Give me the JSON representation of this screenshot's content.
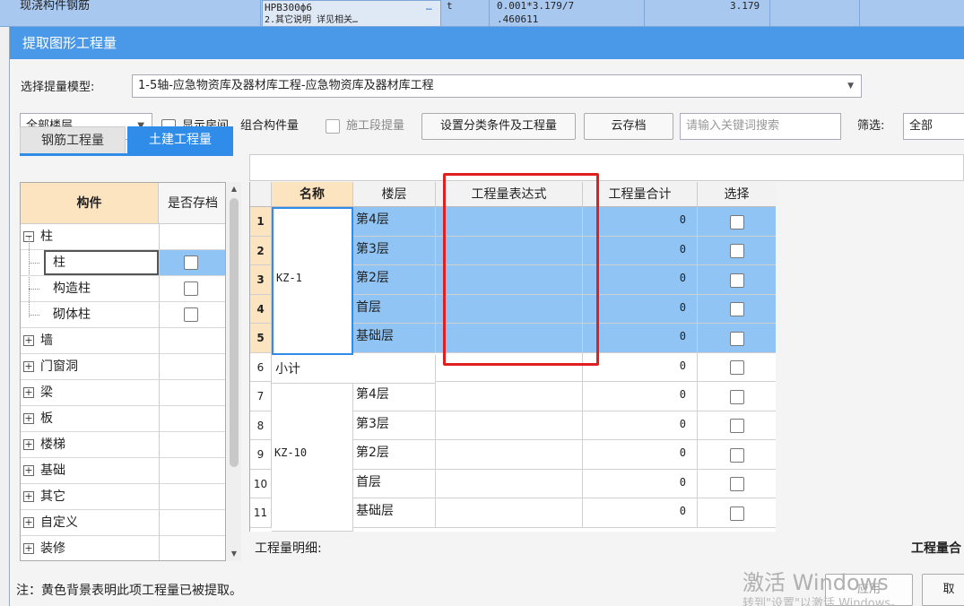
{
  "background_row": {
    "col1": "现浇构件钢筋",
    "col2_line1": "HPB300ф6",
    "col2_line2": "2.其它说明 详见相关…",
    "col2_ellipsis": "…",
    "col3": "t",
    "col4_line1": "0.001*3.179/7",
    "col4_line2": ".460611",
    "col5": "3.179"
  },
  "dialog": {
    "title": "提取图形工程量"
  },
  "model": {
    "label": "选择提量模型:",
    "value": "1-5轴-应急物资库及器材库工程-应急物资库及器材库工程"
  },
  "toolbar": {
    "floor_select": "全部楼层",
    "show_rooms_label": "显示房间、组合构件量",
    "stage_label": "施工段提量",
    "set_btn": "设置分类条件及工程量",
    "cloud_btn": "云存档",
    "search_placeholder": "请输入关键词搜索",
    "filter_label": "筛选:",
    "filter_value": "全部"
  },
  "tabs": [
    {
      "label": "钢筋工程量",
      "active": false
    },
    {
      "label": "土建工程量",
      "active": true
    }
  ],
  "tree": {
    "col_component": "构件",
    "col_saved": "是否存档",
    "items": [
      {
        "label": "柱",
        "expander": "−",
        "level": 0,
        "checkbox": false
      },
      {
        "label": "柱",
        "level": 1,
        "checkbox": true,
        "selected": true
      },
      {
        "label": "构造柱",
        "level": 1,
        "checkbox": true
      },
      {
        "label": "砌体柱",
        "level": 1,
        "checkbox": true
      },
      {
        "label": "墙",
        "expander": "+",
        "level": 0,
        "checkbox": false
      },
      {
        "label": "门窗洞",
        "expander": "+",
        "level": 0,
        "checkbox": false
      },
      {
        "label": "梁",
        "expander": "+",
        "level": 0,
        "checkbox": false
      },
      {
        "label": "板",
        "expander": "+",
        "level": 0,
        "checkbox": false
      },
      {
        "label": "楼梯",
        "expander": "+",
        "level": 0,
        "checkbox": false
      },
      {
        "label": "基础",
        "expander": "+",
        "level": 0,
        "checkbox": false
      },
      {
        "label": "其它",
        "expander": "+",
        "level": 0,
        "checkbox": false
      },
      {
        "label": "自定义",
        "expander": "+",
        "level": 0,
        "checkbox": false
      },
      {
        "label": "装修",
        "expander": "+",
        "level": 0,
        "checkbox": false
      }
    ]
  },
  "grid": {
    "headers": [
      "名称",
      "楼层",
      "工程量表达式",
      "工程量合计",
      "选择"
    ],
    "rows": [
      {
        "n": "1",
        "floor": "第4层",
        "total": "0"
      },
      {
        "n": "2",
        "floor": "第3层",
        "total": "0"
      },
      {
        "n": "3",
        "floor": "第2层",
        "total": "0"
      },
      {
        "n": "4",
        "floor": "首层",
        "total": "0"
      },
      {
        "n": "5",
        "floor": "基础层",
        "total": "0"
      },
      {
        "n": "6",
        "floor": "",
        "total": "0"
      },
      {
        "n": "7",
        "floor": "第4层",
        "total": "0"
      },
      {
        "n": "8",
        "floor": "第3层",
        "total": "0"
      },
      {
        "n": "9",
        "floor": "第2层",
        "total": "0"
      },
      {
        "n": "10",
        "floor": "首层",
        "total": "0"
      },
      {
        "n": "11",
        "floor": "基础层",
        "total": "0"
      }
    ],
    "group1_name": "KZ-1",
    "subtotal_label": "小计",
    "group2_name": "KZ-10"
  },
  "details": {
    "label": "工程量明细:",
    "right_label": "工程量合"
  },
  "note": "注：黄色背景表明此项工程量已被提取。",
  "buttons": {
    "apply": "应用",
    "cancel": "取"
  },
  "watermark": {
    "line1": "激活 Windows",
    "line2": "转到\"设置\"以激活 Windows。"
  },
  "colors": {
    "title_bar": "#4a98e8",
    "tab_active": "#2f8ce8",
    "selection": "#90c4f4",
    "header_highlight": "#fde4c0",
    "annotation": "#e02020"
  }
}
